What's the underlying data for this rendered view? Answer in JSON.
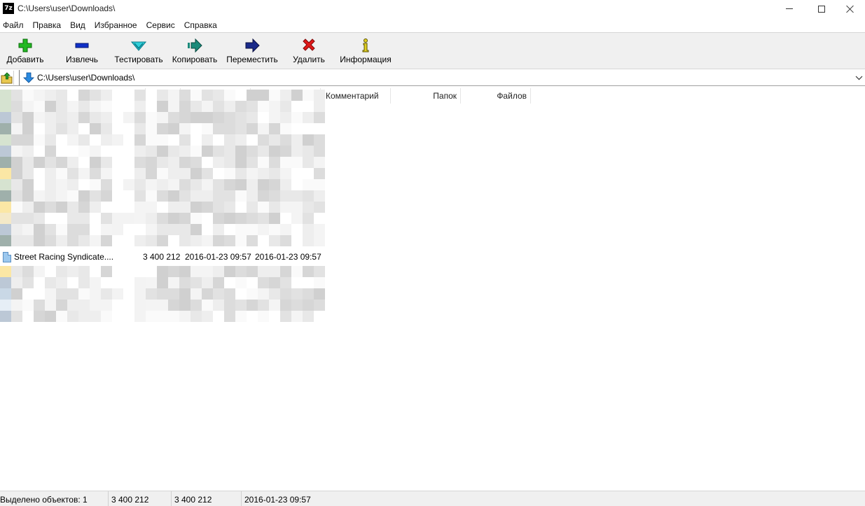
{
  "window": {
    "app_icon_text": "7z",
    "title": "C:\\Users\\user\\Downloads\\",
    "controls": [
      "minimize",
      "maximize",
      "close"
    ]
  },
  "menu": {
    "items": [
      "Файл",
      "Правка",
      "Вид",
      "Избранное",
      "Сервис",
      "Справка"
    ]
  },
  "toolbar": {
    "buttons": [
      {
        "label": "Добавить",
        "icon": "plus-icon",
        "color": "#1fb51f"
      },
      {
        "label": "Извлечь",
        "icon": "minus-icon",
        "color": "#1030c8"
      },
      {
        "label": "Тестировать",
        "icon": "check-down-icon",
        "color": "#27c8d2"
      },
      {
        "label": "Копировать",
        "icon": "copy-arrow-icon",
        "color": "#1a8a7a"
      },
      {
        "label": "Переместить",
        "icon": "move-arrow-icon",
        "color": "#1a2a8a"
      },
      {
        "label": "Удалить",
        "icon": "delete-x-icon",
        "color": "#e01a1a"
      },
      {
        "label": "Информация",
        "icon": "info-icon",
        "color": "#e0d020"
      }
    ]
  },
  "address": {
    "path": "C:\\Users\\user\\Downloads\\"
  },
  "columns": {
    "comment": "Комментарий",
    "folders": "Папок",
    "files": "Файлов"
  },
  "file_row": {
    "name": "Street Racing Syndicate....",
    "size": "3 400 212",
    "modified": "2016-01-23 09:57",
    "created": "2016-01-23 09:57"
  },
  "status": {
    "selected": "Выделено объектов: 1",
    "size": "3 400 212",
    "packed": "3 400 212",
    "date": "2016-01-23 09:57"
  }
}
